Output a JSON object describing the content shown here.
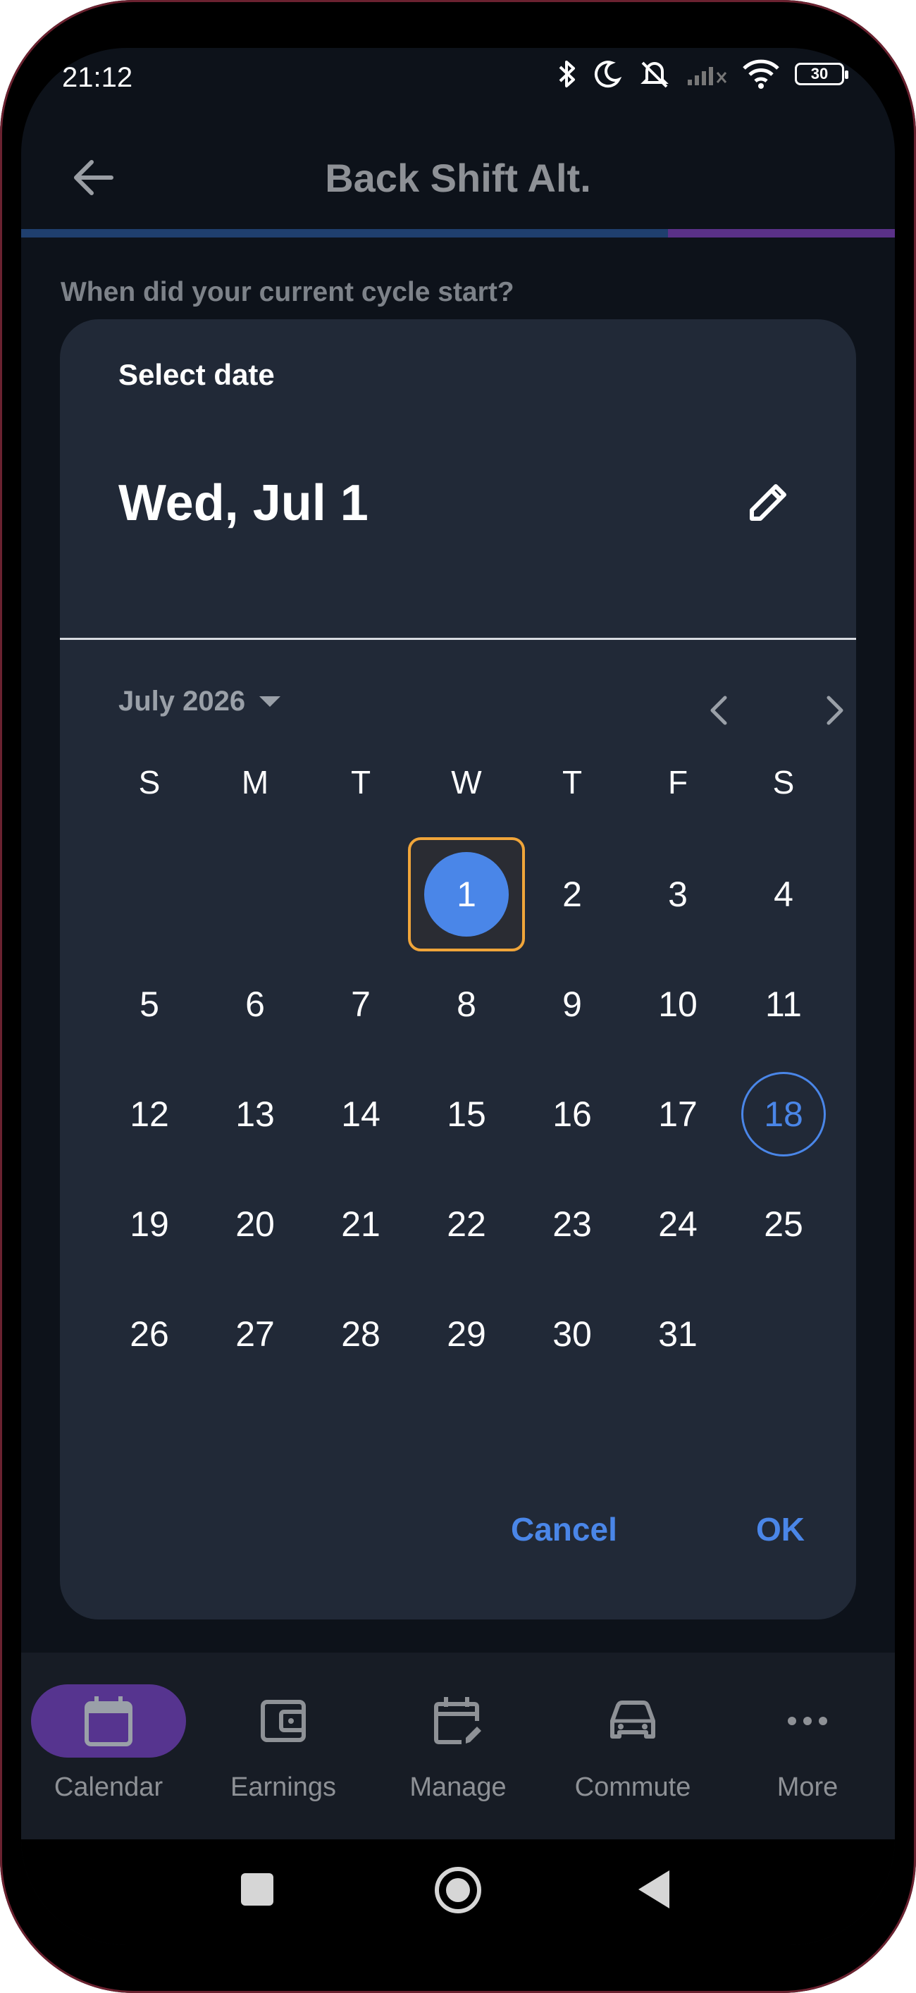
{
  "status_bar": {
    "time": "21:12",
    "battery": "30",
    "icons": [
      "bluetooth-icon",
      "moon-icon",
      "vibrate-off-icon",
      "signal-icon",
      "wifi-icon",
      "battery-icon"
    ]
  },
  "app_bar": {
    "title": "Back Shift Alt.",
    "back_icon": "arrow-left-icon",
    "progress_fraction": 0.74
  },
  "page": {
    "question": "When did your current cycle start?"
  },
  "date_picker": {
    "help_text": "Select date",
    "headline": "Wed, Jul 1",
    "edit_icon": "pencil-icon",
    "month_label": "July 2026",
    "weekdays": [
      "S",
      "M",
      "T",
      "W",
      "T",
      "F",
      "S"
    ],
    "leading_blanks": 3,
    "days": [
      "1",
      "2",
      "3",
      "4",
      "5",
      "6",
      "7",
      "8",
      "9",
      "10",
      "11",
      "12",
      "13",
      "14",
      "15",
      "16",
      "17",
      "18",
      "19",
      "20",
      "21",
      "22",
      "23",
      "24",
      "25",
      "26",
      "27",
      "28",
      "29",
      "30",
      "31"
    ],
    "selected_day": "1",
    "today_day": "18",
    "cancel_label": "Cancel",
    "ok_label": "OK",
    "colors": {
      "accent": "#4a86e8",
      "focus": "#f0a53a",
      "surface": "#212937"
    }
  },
  "bottom_nav": {
    "items": [
      {
        "label": "Calendar",
        "icon": "calendar-icon",
        "active": true
      },
      {
        "label": "Earnings",
        "icon": "wallet-icon",
        "active": false
      },
      {
        "label": "Manage",
        "icon": "calendar-edit-icon",
        "active": false
      },
      {
        "label": "Commute",
        "icon": "car-icon",
        "active": false
      },
      {
        "label": "More",
        "icon": "more-horizontal-icon",
        "active": false
      }
    ],
    "active_color": "#56348f"
  },
  "system_nav": {
    "icons": [
      "recents-icon",
      "home-icon",
      "back-triangle-icon"
    ]
  }
}
